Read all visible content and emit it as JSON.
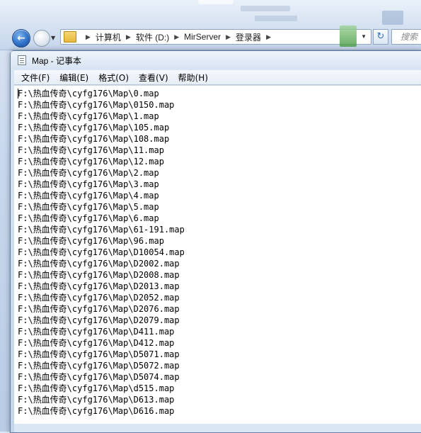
{
  "explorer": {
    "breadcrumbs": [
      "计算机",
      "软件 (D:)",
      "MirServer",
      "登录器"
    ],
    "search_placeholder": "搜索"
  },
  "notepad": {
    "title": "Map - 记事本",
    "menu": [
      "文件(F)",
      "编辑(E)",
      "格式(O)",
      "查看(V)",
      "帮助(H)"
    ],
    "lines": [
      "F:\\热血传奇\\cyfg176\\Map\\0.map",
      "F:\\热血传奇\\cyfg176\\Map\\0150.map",
      "F:\\热血传奇\\cyfg176\\Map\\1.map",
      "F:\\热血传奇\\cyfg176\\Map\\105.map",
      "F:\\热血传奇\\cyfg176\\Map\\108.map",
      "F:\\热血传奇\\cyfg176\\Map\\11.map",
      "F:\\热血传奇\\cyfg176\\Map\\12.map",
      "F:\\热血传奇\\cyfg176\\Map\\2.map",
      "F:\\热血传奇\\cyfg176\\Map\\3.map",
      "F:\\热血传奇\\cyfg176\\Map\\4.map",
      "F:\\热血传奇\\cyfg176\\Map\\5.map",
      "F:\\热血传奇\\cyfg176\\Map\\6.map",
      "F:\\热血传奇\\cyfg176\\Map\\61-191.map",
      "F:\\热血传奇\\cyfg176\\Map\\96.map",
      "F:\\热血传奇\\cyfg176\\Map\\D10054.map",
      "F:\\热血传奇\\cyfg176\\Map\\D2002.map",
      "F:\\热血传奇\\cyfg176\\Map\\D2008.map",
      "F:\\热血传奇\\cyfg176\\Map\\D2013.map",
      "F:\\热血传奇\\cyfg176\\Map\\D2052.map",
      "F:\\热血传奇\\cyfg176\\Map\\D2076.map",
      "F:\\热血传奇\\cyfg176\\Map\\D2079.map",
      "F:\\热血传奇\\cyfg176\\Map\\D411.map",
      "F:\\热血传奇\\cyfg176\\Map\\D412.map",
      "F:\\热血传奇\\cyfg176\\Map\\D5071.map",
      "F:\\热血传奇\\cyfg176\\Map\\D5072.map",
      "F:\\热血传奇\\cyfg176\\Map\\D5074.map",
      "F:\\热血传奇\\cyfg176\\Map\\d515.map",
      "F:\\热血传奇\\cyfg176\\Map\\D613.map",
      "F:\\热血传奇\\cyfg176\\Map\\D616.map"
    ]
  },
  "icons": {
    "back": "back-arrow-icon",
    "forward": "forward-arrow-icon",
    "folder": "folder-icon",
    "refresh": "refresh-icon",
    "notepad": "notepad-icon"
  }
}
